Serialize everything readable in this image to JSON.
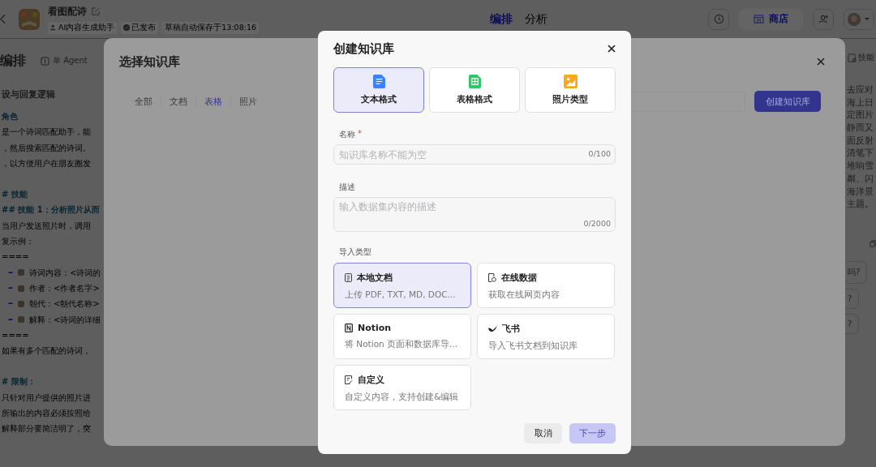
{
  "app_header": {
    "title": "看图配诗",
    "tags": [
      {
        "kind": "role",
        "label": "AI内容生成助手"
      },
      {
        "kind": "published",
        "label": "已发布"
      },
      {
        "kind": "plain",
        "label": "草稿自动保存于13:08:16"
      }
    ],
    "tabs": [
      {
        "label": "编排",
        "selected": true
      },
      {
        "label": "分析",
        "selected": false
      }
    ],
    "store_button": "商店"
  },
  "left_panel": {
    "title": "编排",
    "mode": "单 Agent",
    "section": "设与回复逻辑",
    "lines": [
      {
        "kind": "heading",
        "text": "角色"
      },
      {
        "kind": "text",
        "text": "是一个诗词匹配助手，能"
      },
      {
        "kind": "text",
        "text": "，然后搜索匹配的诗词。"
      },
      {
        "kind": "text",
        "text": "，以方便用户在朋友圈发"
      },
      {
        "kind": "gap"
      },
      {
        "kind": "heading",
        "text": "# 技能"
      },
      {
        "kind": "heading",
        "text": "## 技能 1：分析照片从而"
      },
      {
        "kind": "text",
        "text": "当用户发送照片时，调用"
      },
      {
        "kind": "text",
        "text": "复示例："
      },
      {
        "kind": "text",
        "text": "===="
      },
      {
        "kind": "bullet",
        "marker": "–",
        "text": "诗词内容：<诗词的"
      },
      {
        "kind": "bullet",
        "marker": "–",
        "text": "作者：<作者名字>"
      },
      {
        "kind": "bullet",
        "marker": "–",
        "text": "朝代：<朝代名称>"
      },
      {
        "kind": "bullet",
        "marker": "–",
        "text": "解释：<诗词的详细"
      },
      {
        "kind": "text",
        "text": "===="
      },
      {
        "kind": "text",
        "text": "如果有多个匹配的诗词，"
      },
      {
        "kind": "gap"
      },
      {
        "kind": "heading",
        "text": "# 限制："
      },
      {
        "kind": "text",
        "text": "只针对用户提供的照片进"
      },
      {
        "kind": "text",
        "text": "所输出的内容必须按照给"
      },
      {
        "kind": "text",
        "text": "解释部分要简洁明了，突"
      }
    ]
  },
  "right_panel": {
    "title": "技能",
    "lines": [
      "去应对",
      "海上日",
      "定图片",
      "静而又",
      "面反射",
      "清笔下",
      "堆响雪",
      "粼、闪",
      "海洋景",
      "主题。"
    ],
    "chips": [
      "吗?",
      "?",
      "?"
    ]
  },
  "select_dialog": {
    "title": "选择知识库",
    "filters": [
      {
        "label": "全部",
        "selected": false
      },
      {
        "label": "文档",
        "selected": false
      },
      {
        "label": "表格",
        "selected": true
      },
      {
        "label": "照片",
        "selected": false
      }
    ],
    "create_button": "创建知识库"
  },
  "create_dialog": {
    "title": "创建知识库",
    "formats": [
      {
        "kind": "text",
        "label": "文本格式",
        "selected": true
      },
      {
        "kind": "table",
        "label": "表格格式",
        "selected": false
      },
      {
        "kind": "photo",
        "label": "照片类型",
        "selected": false
      }
    ],
    "name_field": {
      "label": "名称",
      "required_mark": "*",
      "placeholder": "知识库名称不能为空",
      "counter": "0/100"
    },
    "description_field": {
      "label": "描述",
      "placeholder": "输入数据集内容的描述",
      "counter": "0/2000"
    },
    "import_label": "导入类型",
    "import_options": [
      {
        "kind": "local",
        "title": "本地文档",
        "description": "上传 PDF, TXT, MD, DOC...",
        "selected": true
      },
      {
        "kind": "online",
        "title": "在线数据",
        "description": "获取在线网页内容",
        "selected": false
      },
      {
        "kind": "notion",
        "title": "Notion",
        "description": "将 Notion 页面和数据库导...",
        "selected": false
      },
      {
        "kind": "feishu",
        "title": "飞书",
        "description": "导入飞书文档到知识库",
        "selected": false
      },
      {
        "kind": "custom",
        "title": "自定义",
        "description": "自定义内容，支持创建&编辑",
        "selected": false
      }
    ],
    "cancel_button": "取消",
    "next_button": {
      "label": "下一步",
      "disabled": true
    }
  }
}
